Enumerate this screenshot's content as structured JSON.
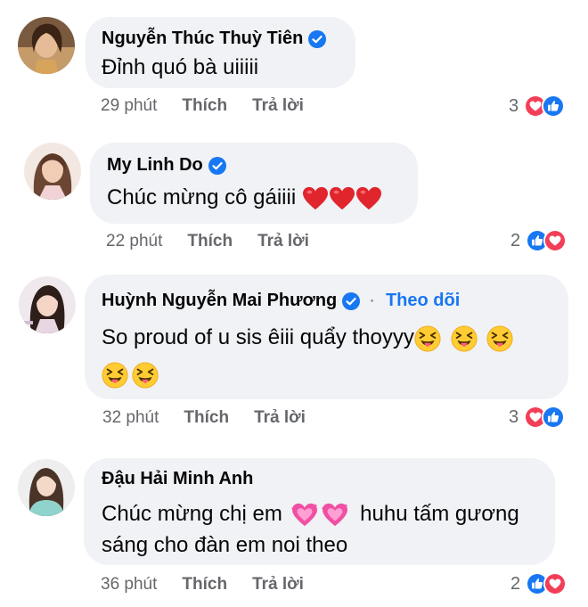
{
  "comments": [
    {
      "name": "Nguyễn Thúc Thuỳ Tiên",
      "verified": true,
      "text": "Đỉnh quó bà uiiiii",
      "time": "29 phút",
      "like": "Thích",
      "reply": "Trả lời",
      "reaction_count": "3",
      "reactions": [
        "love-icon",
        "like-icon"
      ]
    },
    {
      "name": "My Linh Do",
      "verified": true,
      "text": "Chúc mừng cô gáiiii",
      "emojis": [
        "red-heart",
        "red-heart",
        "red-heart"
      ],
      "time": "22 phút",
      "like": "Thích",
      "reply": "Trả lời",
      "reaction_count": "2",
      "reactions": [
        "like-icon",
        "love-icon"
      ]
    },
    {
      "name": "Huỳnh Nguyễn Mai Phương",
      "verified": true,
      "separator": "·",
      "follow": "Theo dõi",
      "text": "So proud of u sis êiii quẩy thoyyy",
      "emojis": [
        "squinting-tongue-face",
        "squinting-tongue-face",
        "squinting-tongue-face",
        "squinting-tongue-face",
        "squinting-tongue-face"
      ],
      "time": "32 phút",
      "like": "Thích",
      "reply": "Trả lời",
      "reaction_count": "3",
      "reactions": [
        "love-icon",
        "like-icon"
      ]
    },
    {
      "name": "Đậu Hải Minh Anh",
      "verified": false,
      "text_line1": "Chúc mừng chị em",
      "text_line1_end": "huhu tấm gương",
      "text_line2": "sáng cho đàn em noi theo",
      "emojis": [
        "sparkling-heart",
        "sparkling-heart"
      ],
      "time": "36 phút",
      "like": "Thích",
      "reply": "Trả lời",
      "reaction_count": "2",
      "reactions": [
        "like-icon",
        "love-icon"
      ]
    }
  ],
  "colors": {
    "bubble": "#f0f2f5",
    "link": "#1877f2",
    "muted": "#65676b",
    "love": "#f33e58",
    "like": "#1877f2"
  }
}
